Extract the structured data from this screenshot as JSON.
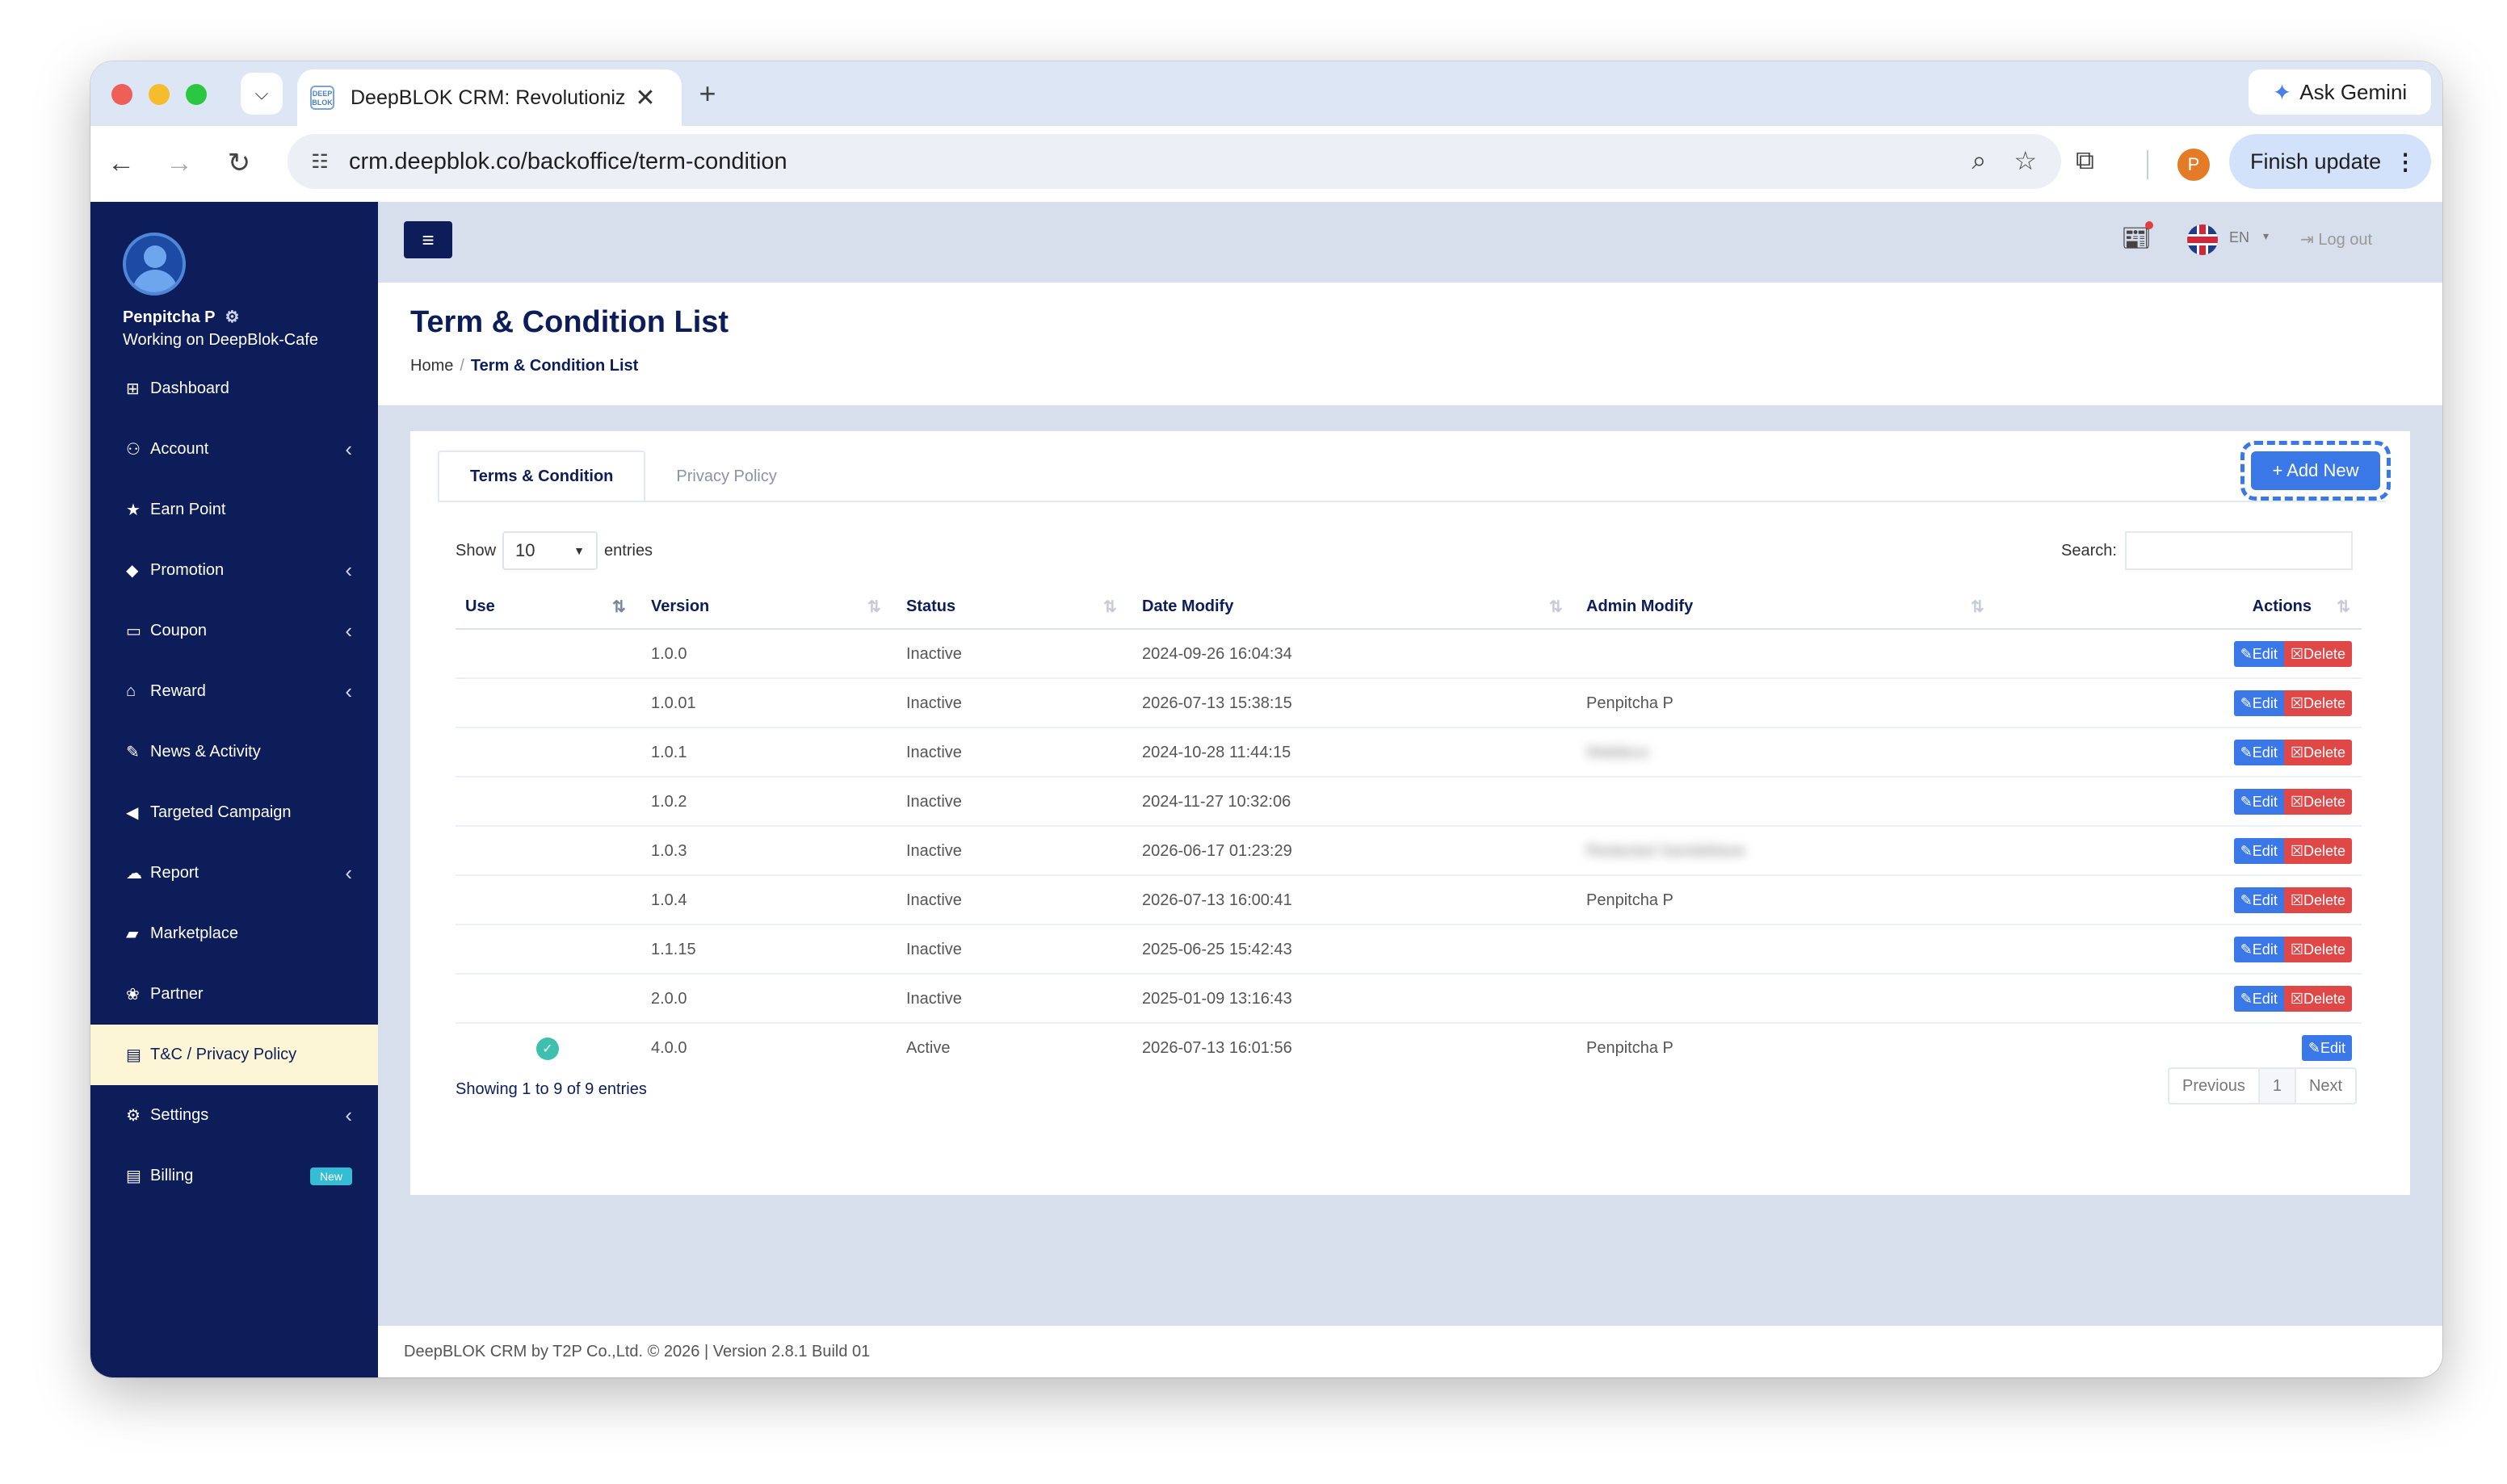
{
  "browser": {
    "tab_title": "DeepBLOK CRM: Revolutioniz",
    "favicon_text": "DEEP BLOK",
    "url": "crm.deepblok.co/backoffice/term-condition",
    "gemini_label": "Ask Gemini",
    "profile_initial": "P",
    "finish_update_label": "Finish update"
  },
  "user": {
    "name": "Penpitcha P",
    "workspace": "Working on DeepBlok-Cafe"
  },
  "sidebar": {
    "items": [
      {
        "label": "Dashboard",
        "icon": "dashboard-icon",
        "chevron": false
      },
      {
        "label": "Account",
        "icon": "users-icon",
        "chevron": true
      },
      {
        "label": "Earn Point",
        "icon": "star-icon",
        "chevron": false
      },
      {
        "label": "Promotion",
        "icon": "tag-icon",
        "chevron": true
      },
      {
        "label": "Coupon",
        "icon": "ticket-icon",
        "chevron": true
      },
      {
        "label": "Reward",
        "icon": "cart-icon",
        "chevron": true
      },
      {
        "label": "News & Activity",
        "icon": "edit-icon",
        "chevron": false
      },
      {
        "label": "Targeted Campaign",
        "icon": "megaphone-icon",
        "chevron": false
      },
      {
        "label": "Report",
        "icon": "cloud-icon",
        "chevron": true
      },
      {
        "label": "Marketplace",
        "icon": "bag-icon",
        "chevron": false
      },
      {
        "label": "Partner",
        "icon": "handshake-icon",
        "chevron": false
      },
      {
        "label": "T&C / Privacy Policy",
        "icon": "document-icon",
        "chevron": false,
        "active": true
      },
      {
        "label": "Settings",
        "icon": "gear-icon",
        "chevron": true
      },
      {
        "label": "Billing",
        "icon": "invoice-icon",
        "chevron": false,
        "badge": "New"
      }
    ]
  },
  "topnav": {
    "language": "EN",
    "logout_label": "Log out"
  },
  "page": {
    "title": "Term & Condition List",
    "breadcrumb": [
      "Home",
      "Term & Condition List"
    ]
  },
  "tabs": [
    "Terms & Condition",
    "Privacy Policy"
  ],
  "add_new_label": "+ Add New",
  "controls": {
    "show_label": "Show",
    "entries_value": "10",
    "entries_label": "entries",
    "search_label": "Search:",
    "search_value": ""
  },
  "table": {
    "columns": [
      "Use",
      "Version",
      "Status",
      "Date Modify",
      "Admin Modify",
      "Actions"
    ],
    "edit_label": "Edit",
    "delete_label": "Delete",
    "rows": [
      {
        "use": "",
        "version": "1.0.0",
        "status": "Inactive",
        "date": "2024-09-26 16:04:34",
        "admin": "",
        "delete": true
      },
      {
        "use": "",
        "version": "1.0.01",
        "status": "Inactive",
        "date": "2026-07-13 15:38:15",
        "admin": "Penpitcha P",
        "delete": true
      },
      {
        "use": "",
        "version": "1.0.1",
        "status": "Inactive",
        "date": "2024-10-28 11:44:15",
        "admin": "Waldeco",
        "admin_blurred": true,
        "delete": true
      },
      {
        "use": "",
        "version": "1.0.2",
        "status": "Inactive",
        "date": "2024-11-27 10:32:06",
        "admin": "",
        "delete": true
      },
      {
        "use": "",
        "version": "1.0.3",
        "status": "Inactive",
        "date": "2026-06-17 01:23:29",
        "admin": "Redacted Sandeblave",
        "admin_blurred": true,
        "delete": true
      },
      {
        "use": "",
        "version": "1.0.4",
        "status": "Inactive",
        "date": "2026-07-13 16:00:41",
        "admin": "Penpitcha P",
        "delete": true
      },
      {
        "use": "",
        "version": "1.1.15",
        "status": "Inactive",
        "date": "2025-06-25 15:42:43",
        "admin": "",
        "delete": true
      },
      {
        "use": "",
        "version": "2.0.0",
        "status": "Inactive",
        "date": "2025-01-09 13:16:43",
        "admin": "",
        "delete": true
      },
      {
        "use": "check",
        "version": "4.0.0",
        "status": "Active",
        "date": "2026-07-13 16:01:56",
        "admin": "Penpitcha P",
        "delete": false
      }
    ]
  },
  "pagination": {
    "info": "Showing 1 to 9 of 9 entries",
    "previous": "Previous",
    "page": "1",
    "next": "Next"
  },
  "footer": "DeepBLOK CRM by T2P Co.,Ltd. © 2026 | Version 2.8.1 Build 01",
  "colors": {
    "sidebar_bg": "#0d1d5a",
    "active_item_bg": "#fcf6d6",
    "primary": "#3b78e7",
    "danger": "#e04848",
    "content_bg": "#d7dfec"
  }
}
